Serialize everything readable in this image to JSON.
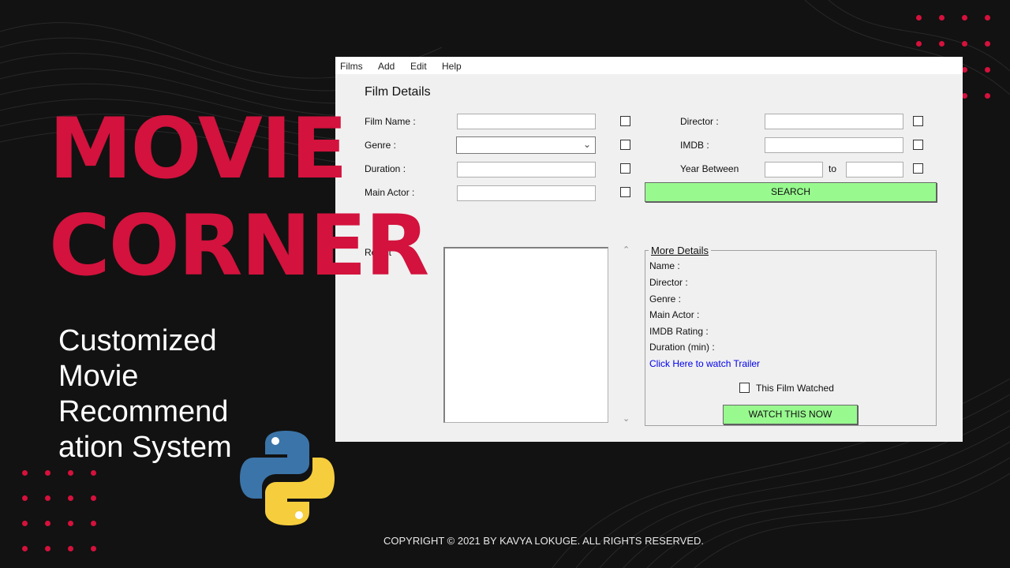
{
  "window": {
    "menu": [
      "Films",
      "Add",
      "Edit",
      "Help"
    ],
    "film_details": {
      "title": "Film Details",
      "film_name_label": "Film Name :",
      "genre_label": "Genre :",
      "duration_label": "Duration :",
      "main_actor_label": "Main Actor :",
      "director_label": "Director :",
      "imdb_label": "IMDB   :",
      "year_between_label": "Year Between",
      "to_label": "to",
      "search_button": "SEARCH"
    },
    "results_label": "Result",
    "more_details": {
      "title": "More Details",
      "name_label": "Name :",
      "director_label": "Director :",
      "genre_label": "Genre :",
      "main_actor_label": "Main Actor :",
      "imdb_rating_label": "IMDB Rating :",
      "duration_label": "Duration (min) :",
      "trailer_link": "Click Here to watch Trailer",
      "watched_label": "This Film Watched",
      "watch_button": "WATCH THIS NOW"
    }
  },
  "hero": {
    "title_line1": "MOVIE",
    "title_line2": "CORNER",
    "subtitle_lines": [
      "Customized",
      "Movie",
      "Recommend",
      "ation System"
    ]
  },
  "copyright": "COPYRIGHT © 2021 BY  KAVYA LOKUGE. ALL RIGHTS RESERVED.",
  "icons": [
    "python-logo-icon",
    "chevron-down-icon",
    "scroll-up-icon",
    "scroll-down-icon"
  ],
  "colors": {
    "background": "#121212",
    "accent_red": "#d3123d",
    "button_green": "#98f98f",
    "window_bg": "#f0f0f0",
    "link_blue": "#0000ee"
  }
}
